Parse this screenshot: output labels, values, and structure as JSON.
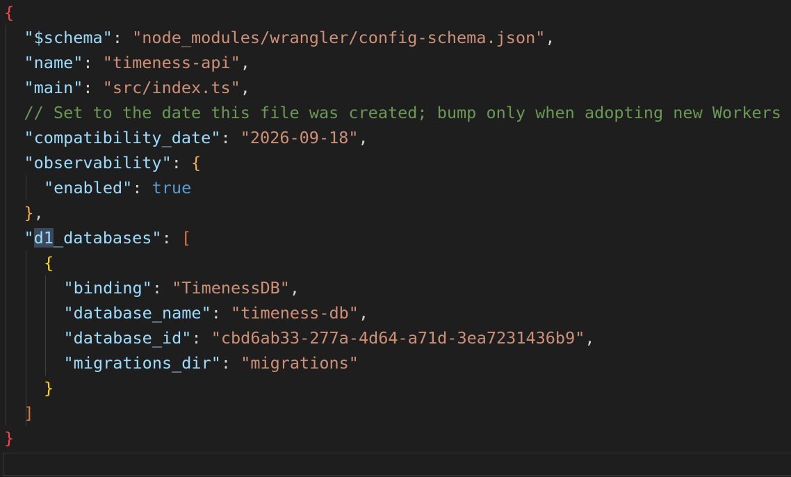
{
  "editor": {
    "lines": [
      {
        "indent": 0,
        "tokens": [
          {
            "t": "{",
            "c": "tok-brace-1 red"
          }
        ]
      },
      {
        "indent": 1,
        "tokens": [
          {
            "t": "\"$schema\"",
            "c": "tok-key"
          },
          {
            "t": ": ",
            "c": "tok-punc"
          },
          {
            "t": "\"node_modules/wrangler/config-schema.json\"",
            "c": "tok-str"
          },
          {
            "t": ",",
            "c": "tok-punc"
          }
        ]
      },
      {
        "indent": 1,
        "tokens": [
          {
            "t": "\"name\"",
            "c": "tok-key"
          },
          {
            "t": ": ",
            "c": "tok-punc"
          },
          {
            "t": "\"timeness-api\"",
            "c": "tok-str"
          },
          {
            "t": ",",
            "c": "tok-punc"
          }
        ]
      },
      {
        "indent": 1,
        "tokens": [
          {
            "t": "\"main\"",
            "c": "tok-key"
          },
          {
            "t": ": ",
            "c": "tok-punc"
          },
          {
            "t": "\"src/index.ts\"",
            "c": "tok-str"
          },
          {
            "t": ",",
            "c": "tok-punc"
          }
        ]
      },
      {
        "indent": 1,
        "tokens": [
          {
            "t": "// Set to the date this file was created; bump only when adopting new Workers",
            "c": "tok-comment"
          }
        ]
      },
      {
        "indent": 1,
        "tokens": [
          {
            "t": "\"compatibility_date\"",
            "c": "tok-key"
          },
          {
            "t": ": ",
            "c": "tok-punc"
          },
          {
            "t": "\"2026-09-18\"",
            "c": "tok-str"
          },
          {
            "t": ",",
            "c": "tok-punc"
          }
        ]
      },
      {
        "indent": 1,
        "tokens": [
          {
            "t": "\"observability\"",
            "c": "tok-key"
          },
          {
            "t": ": ",
            "c": "tok-punc"
          },
          {
            "t": "{",
            "c": "tok-brace-2"
          }
        ]
      },
      {
        "indent": 2,
        "tokens": [
          {
            "t": "\"enabled\"",
            "c": "tok-key"
          },
          {
            "t": ": ",
            "c": "tok-punc"
          },
          {
            "t": "true",
            "c": "tok-bool"
          }
        ]
      },
      {
        "indent": 1,
        "tokens": [
          {
            "t": "}",
            "c": "tok-brace-2"
          },
          {
            "t": ",",
            "c": "tok-punc"
          }
        ]
      },
      {
        "indent": 1,
        "tokens": [
          {
            "t": "\"",
            "c": "tok-key"
          },
          {
            "t": "d1",
            "c": "tok-key cursor-sel"
          },
          {
            "t": "_databases\"",
            "c": "tok-key"
          },
          {
            "t": ": ",
            "c": "tok-punc"
          },
          {
            "t": "[",
            "c": "tok-bracket"
          }
        ]
      },
      {
        "indent": 2,
        "tokens": [
          {
            "t": "{",
            "c": "tok-brace-3"
          }
        ]
      },
      {
        "indent": 3,
        "tokens": [
          {
            "t": "\"binding\"",
            "c": "tok-key"
          },
          {
            "t": ": ",
            "c": "tok-punc"
          },
          {
            "t": "\"TimenessDB\"",
            "c": "tok-str"
          },
          {
            "t": ",",
            "c": "tok-punc"
          }
        ]
      },
      {
        "indent": 3,
        "tokens": [
          {
            "t": "\"database_name\"",
            "c": "tok-key"
          },
          {
            "t": ": ",
            "c": "tok-punc"
          },
          {
            "t": "\"timeness-db\"",
            "c": "tok-str"
          },
          {
            "t": ",",
            "c": "tok-punc"
          }
        ]
      },
      {
        "indent": 3,
        "tokens": [
          {
            "t": "\"database_id\"",
            "c": "tok-key"
          },
          {
            "t": ": ",
            "c": "tok-punc"
          },
          {
            "t": "\"cbd6ab33-277a-4d64-a71d-3ea7231436b9\"",
            "c": "tok-str"
          },
          {
            "t": ",",
            "c": "tok-punc"
          }
        ]
      },
      {
        "indent": 3,
        "tokens": [
          {
            "t": "\"migrations_dir\"",
            "c": "tok-key"
          },
          {
            "t": ": ",
            "c": "tok-punc"
          },
          {
            "t": "\"migrations\"",
            "c": "tok-str"
          }
        ]
      },
      {
        "indent": 2,
        "tokens": [
          {
            "t": "}",
            "c": "tok-brace-3"
          }
        ]
      },
      {
        "indent": 1,
        "tokens": [
          {
            "t": "]",
            "c": "tok-bracket"
          }
        ]
      },
      {
        "indent": 0,
        "tokens": [
          {
            "t": "}",
            "c": "tok-brace-1 red"
          }
        ]
      }
    ]
  },
  "colors": {
    "background": "#1e1e1e",
    "key": "#9cdcfe",
    "string": "#ce9178",
    "boolean": "#569cd6",
    "comment": "#6a9955",
    "brace_outer": "#f44747",
    "brace_level2": "#f5b14d",
    "brace_level3": "#ffd700",
    "bracket": "#d97b45"
  }
}
